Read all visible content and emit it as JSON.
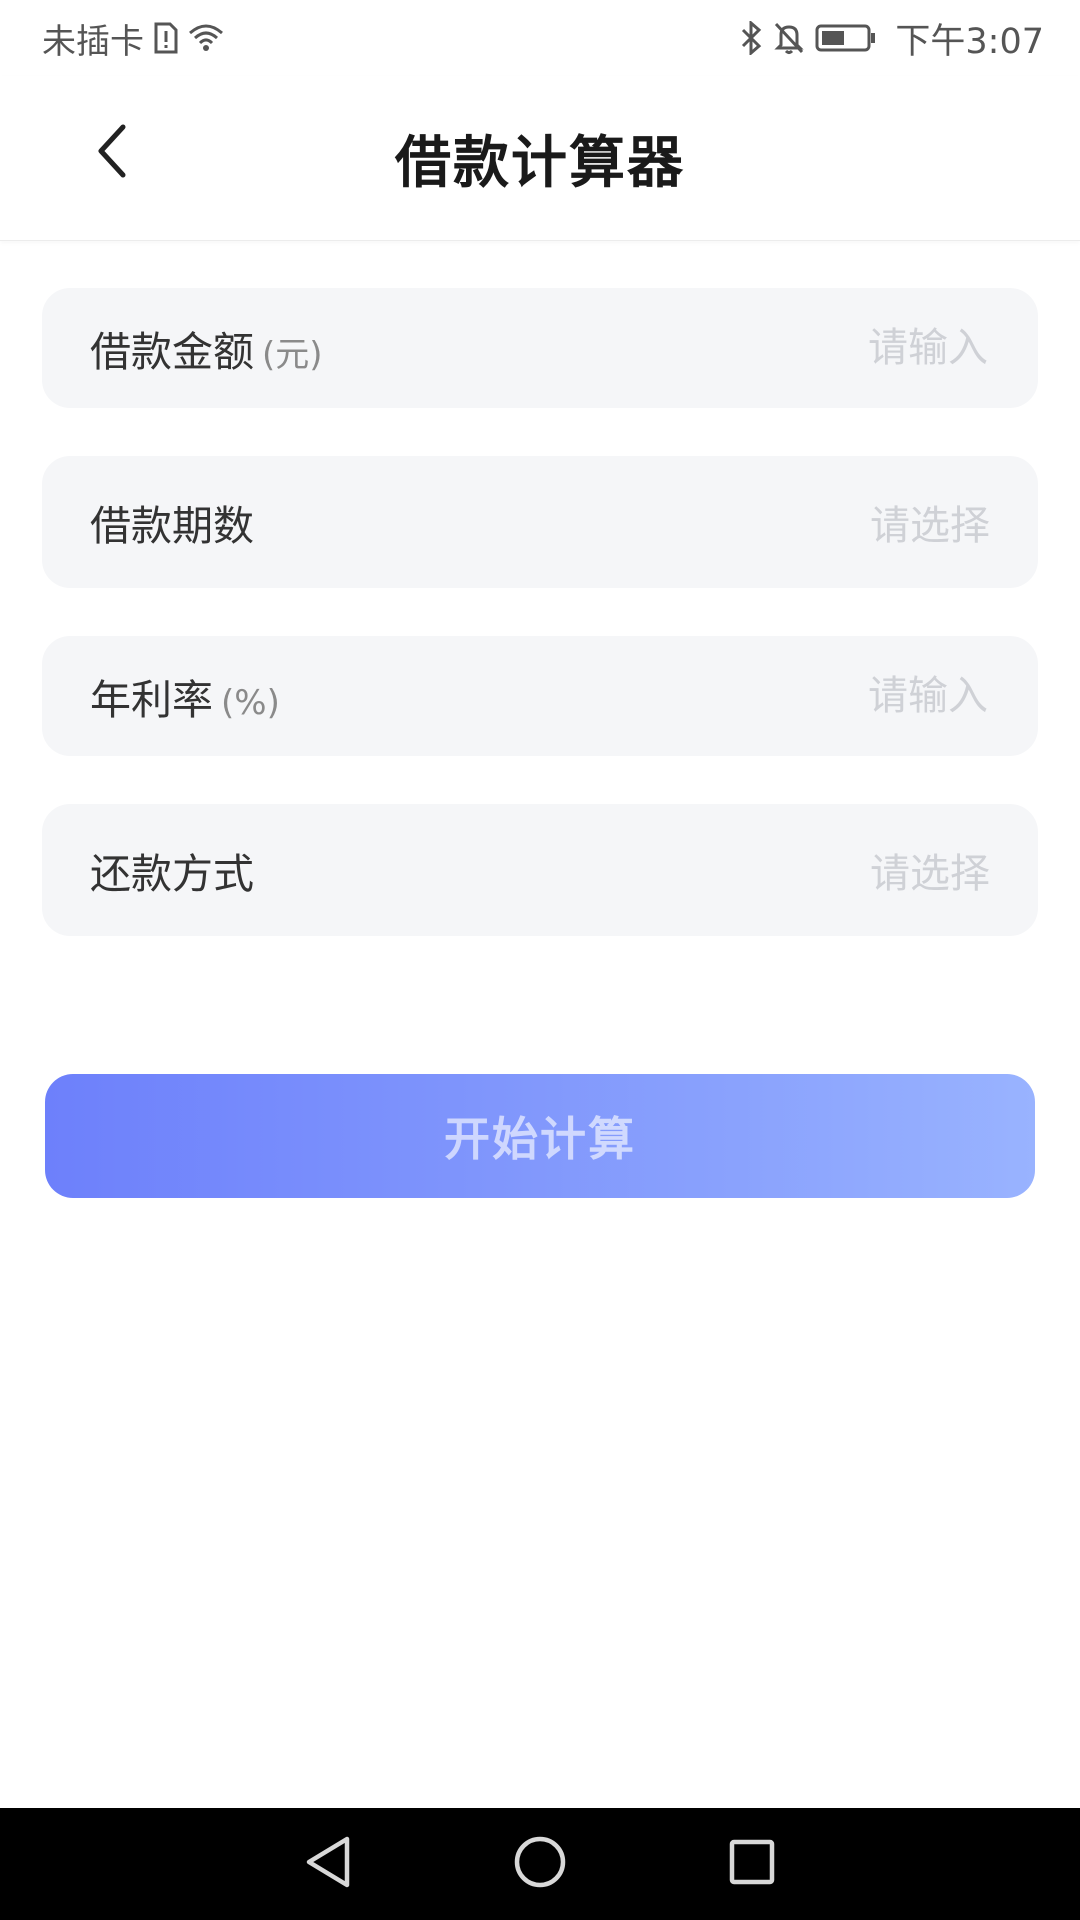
{
  "status_bar": {
    "carrier": "未插卡",
    "time": "下午3:07",
    "icons": [
      "sim-alert-icon",
      "wifi-icon",
      "bluetooth-icon",
      "mute-bell-icon",
      "battery-icon"
    ]
  },
  "header": {
    "title": "借款计算器",
    "back_icon": "chevron-left-icon"
  },
  "form": {
    "loan_amount": {
      "label": "借款金额",
      "unit": "(元)",
      "placeholder": "请输入"
    },
    "loan_periods": {
      "label": "借款期数",
      "value": "请选择"
    },
    "annual_rate": {
      "label": "年利率",
      "unit": "(%)",
      "placeholder": "请输入"
    },
    "repayment_method": {
      "label": "还款方式",
      "value": "请选择"
    }
  },
  "actions": {
    "calculate_label": "开始计算"
  },
  "colors": {
    "button_gradient_start": "#6d80fb",
    "button_gradient_end": "#99b3ff",
    "field_background": "#f5f6f8",
    "placeholder": "#cfd1d6"
  },
  "nav_bar": {
    "icons": [
      "back-triangle-icon",
      "home-circle-icon",
      "recents-square-icon"
    ]
  }
}
